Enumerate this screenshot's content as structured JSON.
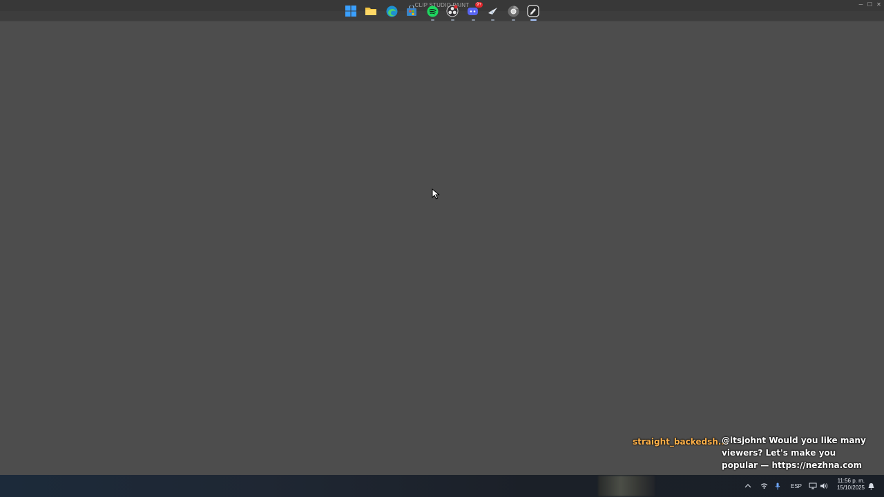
{
  "window": {
    "title": "CLIP STUDIO PAINT",
    "controls": {
      "minimize": "─",
      "maximize": "☐",
      "close": "✕"
    }
  },
  "chat": {
    "username": "straight_backedsh...",
    "message": "@itsjohnt Would you like many viewers? Let's make you popular — https://nezhna.com",
    "username_color": "#ffb24a"
  },
  "taskbar": {
    "apps": [
      {
        "name": "windows-start-icon"
      },
      {
        "name": "file-explorer-icon"
      },
      {
        "name": "edge-browser-icon"
      },
      {
        "name": "microsoft-store-icon"
      },
      {
        "name": "spotify-icon"
      },
      {
        "name": "obs-icon"
      },
      {
        "name": "discord-icon",
        "badge": "9+"
      },
      {
        "name": "steam-icon"
      },
      {
        "name": "chrome-icon"
      },
      {
        "name": "clip-studio-icon"
      }
    ],
    "tray": {
      "language": "ESP",
      "time": "11:56 p. m.",
      "date": "15/10/2025"
    }
  },
  "colors": {
    "canvas_bg": "#4d4d4d",
    "titlebar_bg": "#383838",
    "taskbar_bg": "#1f2733"
  }
}
